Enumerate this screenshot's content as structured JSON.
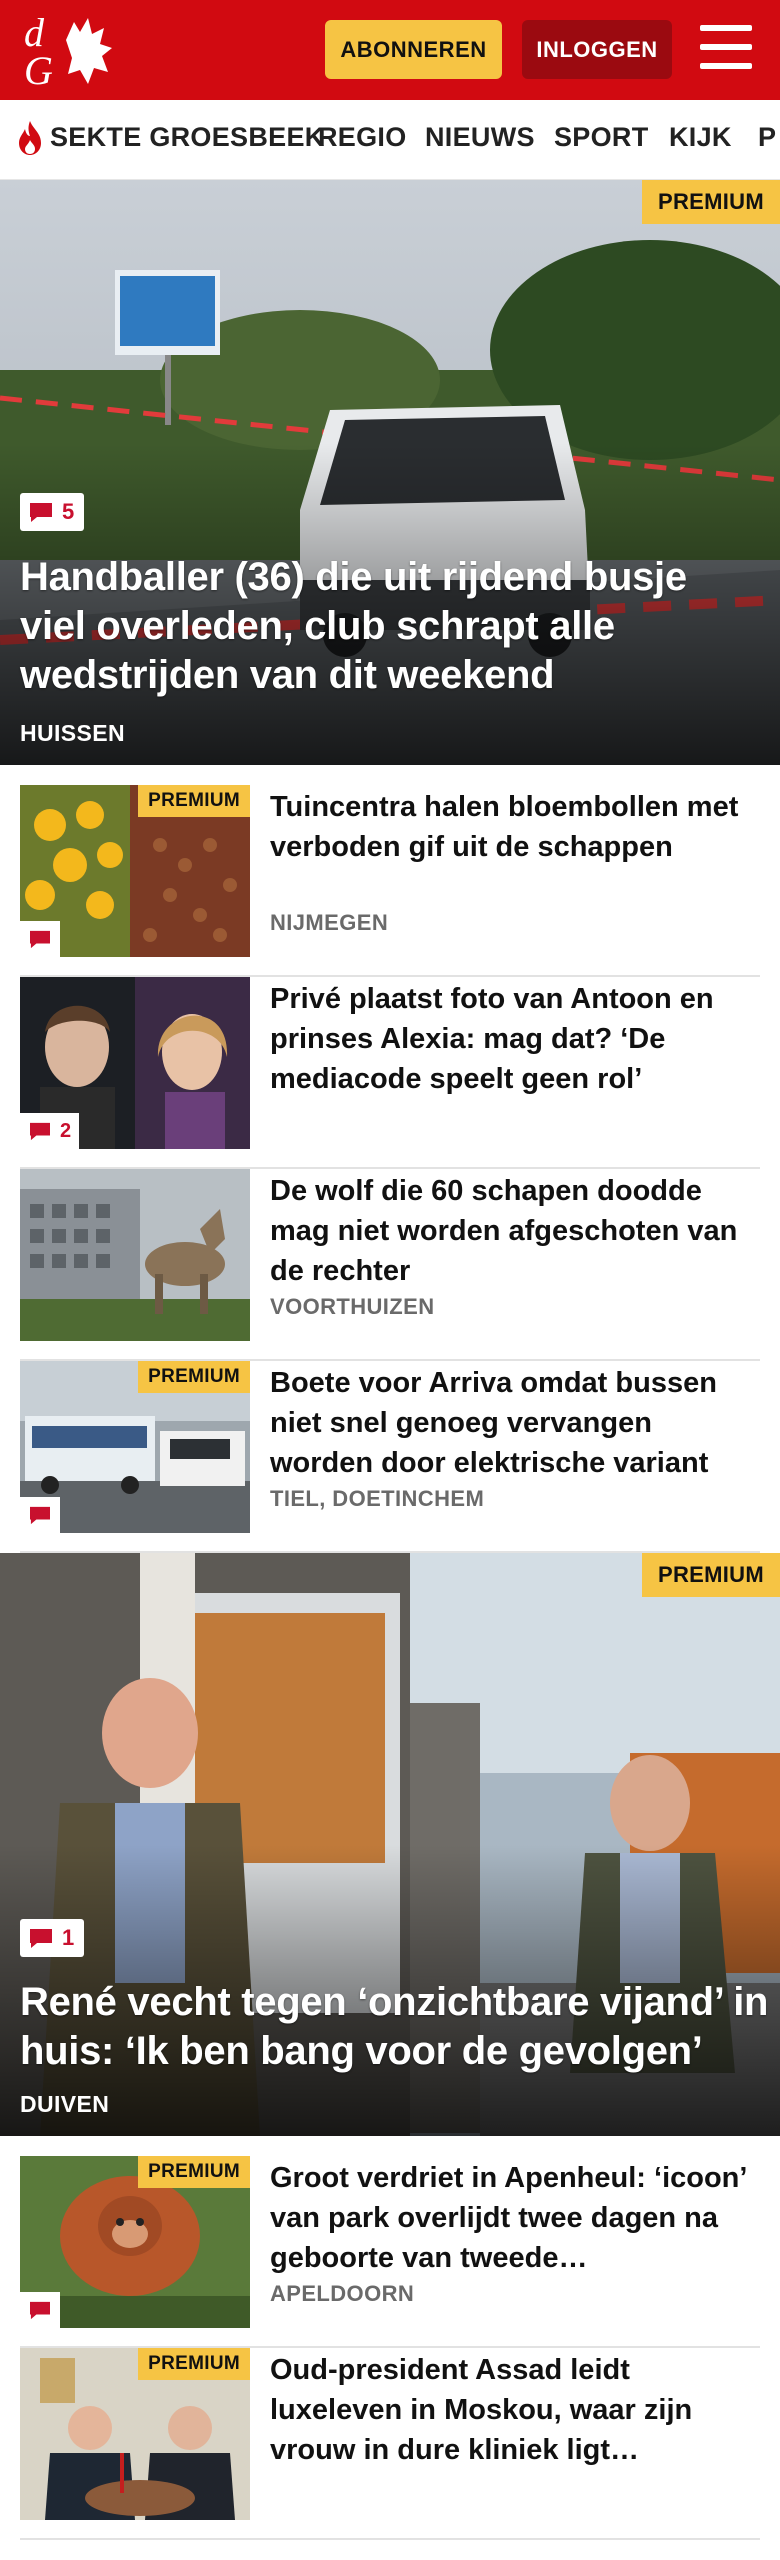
{
  "header": {
    "logo_text": "dG",
    "subscribe_label": "ABONNEREN",
    "login_label": "INLOGGEN",
    "brand_color": "#d10a11",
    "accent_color": "#f6c444"
  },
  "nav": {
    "items": [
      {
        "label": "SEKTE GROESBEEK",
        "icon": "flame-icon"
      },
      {
        "label": "REGIO"
      },
      {
        "label": "NIEUWS"
      },
      {
        "label": "SPORT"
      },
      {
        "label": "KIJK"
      },
      {
        "label": "P"
      }
    ]
  },
  "hero1": {
    "premium": "PREMIUM",
    "comments": "5",
    "title": "Handballer (36) die uit rijdend busje viel overleden, club schrapt alle wedstrijden van dit weekend",
    "location": "HUISSEN"
  },
  "articles1": [
    {
      "title": "Tuincentra halen bloembollen met verboden gif uit de schappen",
      "location": "NIJMEGEN",
      "premium": "PREMIUM",
      "comments": ""
    },
    {
      "title": "Privé plaatst foto van Antoon en prinses Alexia: mag dat? ‘De mediacode speelt geen rol’",
      "location": "",
      "premium": "",
      "comments": "2"
    },
    {
      "title": "De wolf die 60 schapen doodde mag niet worden afgeschoten van de rechter",
      "location": "VOORTHUIZEN",
      "premium": "",
      "comments": ""
    },
    {
      "title": "Boete voor Arriva omdat bussen niet snel genoeg vervangen worden door elektrische variant",
      "location": "TIEL, DOETINCHEM",
      "premium": "PREMIUM",
      "comments": ""
    }
  ],
  "hero2": {
    "premium": "PREMIUM",
    "comments": "1",
    "title": "René vecht tegen ‘onzichtbare vijand’ in huis: ‘Ik ben bang voor de gevolgen’",
    "location": "DUIVEN"
  },
  "articles2": [
    {
      "title": "Groot verdriet in Apenheul: ‘icoon’ van park overlijdt twee dagen na geboorte van tweede…",
      "location": "APELDOORN",
      "premium": "PREMIUM",
      "comments": ""
    },
    {
      "title": "Oud-president Assad leidt luxeleven in Moskou, waar zijn vrouw in dure kliniek ligt…",
      "location": "",
      "premium": "PREMIUM",
      "comments": ""
    }
  ]
}
